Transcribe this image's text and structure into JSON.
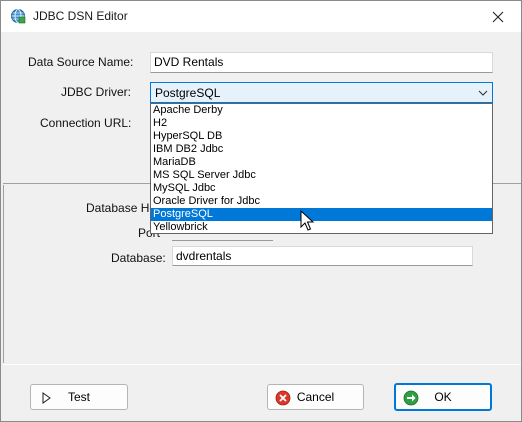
{
  "window": {
    "title": "JDBC DSN Editor"
  },
  "form": {
    "data_source_name": {
      "label": "Data Source Name:",
      "value": "DVD Rentals"
    },
    "jdbc_driver": {
      "label": "JDBC Driver:",
      "value": "PostgreSQL"
    },
    "connection_url": {
      "label": "Connection URL:"
    },
    "database_host": {
      "label": "Database Ho"
    },
    "port": {
      "label": "Port"
    },
    "database": {
      "label": "Database:",
      "value": "dvdrentals"
    }
  },
  "driver_options": [
    "Apache Derby",
    "H2",
    "HyperSQL DB",
    "IBM DB2 Jdbc",
    "MariaDB",
    "MS SQL Server Jdbc",
    "MySQL Jdbc",
    "Oracle Driver for Jdbc",
    "PostgreSQL",
    "Yellowbrick"
  ],
  "selected_option_index": 8,
  "buttons": {
    "test": "Test",
    "cancel": "Cancel",
    "ok": "OK"
  },
  "colors": {
    "accent": "#0078d7",
    "cancel_red": "#d9382b",
    "ok_green": "#2ea043"
  },
  "icons": {
    "app": "jdbc-globe-icon",
    "close": "close-icon",
    "test": "play-icon",
    "cancel": "cancel-x-icon",
    "ok": "ok-arrow-icon",
    "combo": "chevron-down-icon"
  }
}
